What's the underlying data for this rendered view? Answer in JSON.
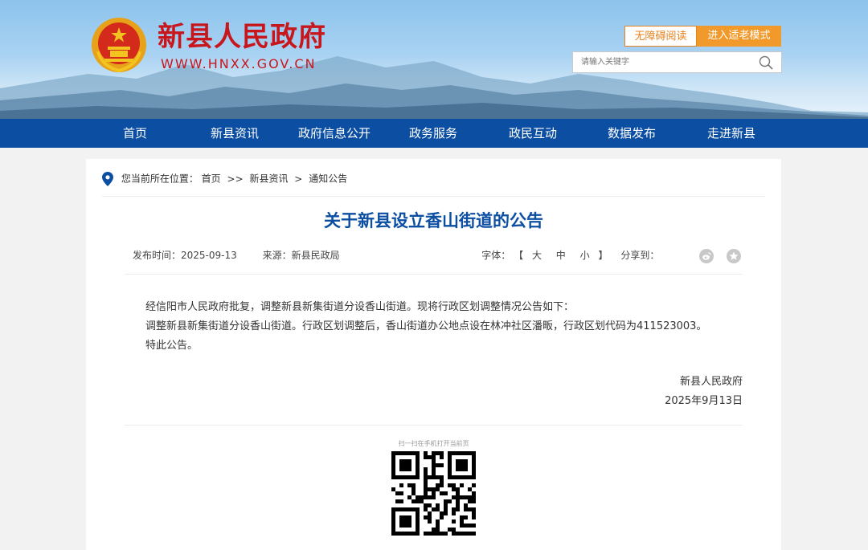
{
  "header": {
    "site_title": "新县人民政府",
    "site_domain": "WWW.HNXX.GOV.CN",
    "accessible_btn": "无障碍阅读",
    "elderly_btn": "进入适老模式",
    "search_placeholder": "请输入关键字"
  },
  "nav": {
    "items": [
      "首页",
      "新县资讯",
      "政府信息公开",
      "政务服务",
      "政民互动",
      "数据发布",
      "走进新县"
    ]
  },
  "breadcrumb": {
    "prefix": "您当前所在位置：",
    "items": [
      "首页",
      "新县资讯",
      "通知公告"
    ],
    "sep1": ">>",
    "sep2": ">"
  },
  "article": {
    "title": "关于新县设立香山街道的公告",
    "publish_time_label": "发布时间：2025-09-13",
    "source_label": "来源：新县民政局",
    "font_size_label": "字体：",
    "font_bracket_open": "【",
    "font_large": "大",
    "font_medium": "中",
    "font_small": "小",
    "font_bracket_close": "】",
    "share_label": "分享到：",
    "paragraphs": [
      "经信阳市人民政府批复，调整新县新集街道分设香山街道。现将行政区划调整情况公告如下：",
      "调整新县新集街道分设香山街道。行政区划调整后，香山街道办公地点设在林冲社区潘畈，行政区划代码为411523003。",
      "特此公告。"
    ],
    "signature_org": "新县人民政府",
    "signature_date": "2025年9月13日"
  },
  "qr": {
    "caption": "扫一扫在手机打开当前页"
  },
  "colors": {
    "brand_red": "#c8161d",
    "nav_blue": "#0b4ea2",
    "accent_orange": "#f19a2b"
  }
}
